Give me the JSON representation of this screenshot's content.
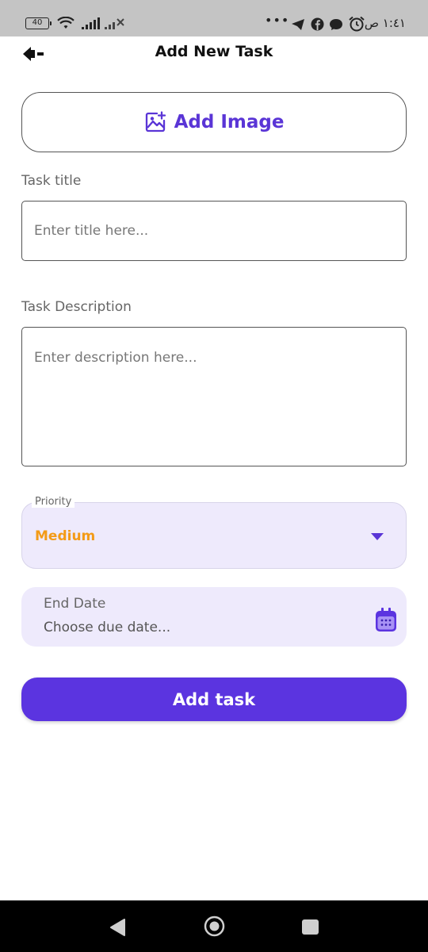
{
  "status_bar": {
    "battery": "40",
    "dots": "•••",
    "time": "١:٤١ ص"
  },
  "app_bar": {
    "title": "Add New Task"
  },
  "add_image": {
    "label": "Add Image"
  },
  "title_field": {
    "label": "Task title",
    "placeholder": "Enter title here..."
  },
  "description_field": {
    "label": "Task Description",
    "placeholder": "Enter description here..."
  },
  "priority": {
    "label": "Priority",
    "value": "Medium",
    "value_color": "#f39b17"
  },
  "end_date": {
    "label": "End Date",
    "placeholder": "Choose due date..."
  },
  "submit": {
    "label": "Add task"
  },
  "colors": {
    "accent": "#5b34e0",
    "field_fill": "#eeeafc"
  },
  "icons": [
    "back-arrow-icon",
    "add-image-icon",
    "dropdown-caret-icon",
    "calendar-icon",
    "nav-back-icon",
    "nav-home-icon",
    "nav-recents-icon"
  ]
}
